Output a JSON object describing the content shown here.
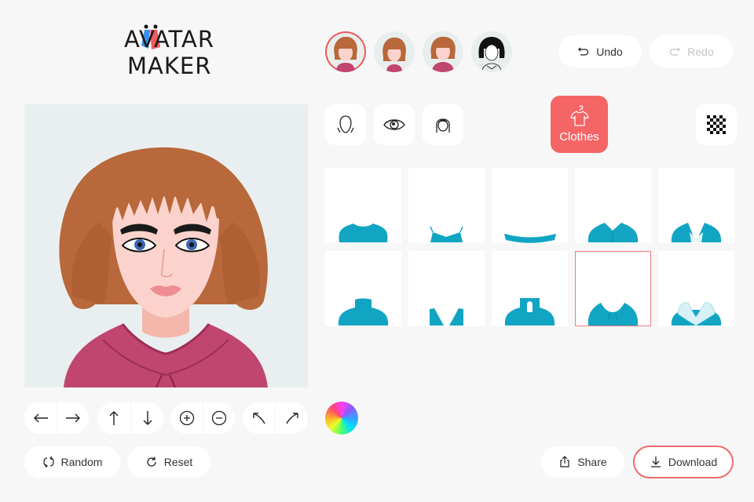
{
  "app": {
    "logo_line1": "AVATAR",
    "logo_line2": "MAKER",
    "logo_colors": {
      "blue": "#3a8ef0",
      "red": "#f25a5a"
    }
  },
  "presets": [
    {
      "name": "curly-hair-preset-1",
      "selected": true
    },
    {
      "name": "curly-hair-preset-2",
      "selected": false
    },
    {
      "name": "curly-hair-preset-3",
      "selected": false
    },
    {
      "name": "bob-hair-sketch-preset",
      "selected": false
    }
  ],
  "history": {
    "undo_label": "Undo",
    "redo_label": "Redo",
    "undo_icon": "undo-icon",
    "redo_icon": "redo-icon",
    "redo_enabled": false
  },
  "categories": [
    {
      "id": "face",
      "icon": "face-shape-icon",
      "active": false
    },
    {
      "id": "eyes",
      "icon": "eye-icon",
      "active": false
    },
    {
      "id": "hair",
      "icon": "hair-icon",
      "active": false
    },
    {
      "id": "clothes",
      "label": "Clothes",
      "icon": "hanger-shirt-icon",
      "active": true
    },
    {
      "id": "background",
      "icon": "checkerboard-icon",
      "active": false
    }
  ],
  "clothes_items": [
    {
      "style": "crew-neck-top",
      "selected": false
    },
    {
      "style": "strappy-top",
      "selected": false
    },
    {
      "style": "ruffle-off-shoulder",
      "selected": false
    },
    {
      "style": "collared-shirt",
      "selected": false
    },
    {
      "style": "blazer-with-tee",
      "selected": false
    },
    {
      "style": "turtleneck",
      "selected": false
    },
    {
      "style": "v-neck-tank",
      "selected": false
    },
    {
      "style": "keyhole-high-neck",
      "selected": false
    },
    {
      "style": "hoodie",
      "selected": true
    },
    {
      "style": "fur-collar-coat",
      "selected": false
    }
  ],
  "colors": {
    "accent": "#f56565",
    "clothing": "#12a5c3",
    "canvas_bg": "#e9eff0",
    "page_bg": "#f7f7f7",
    "hoodie": "#c0456f",
    "hair": "#b8683a",
    "skin": "#fbd3cc"
  },
  "position_controls": [
    {
      "group": "horizontal",
      "buttons": [
        "arrow-left-icon",
        "arrow-right-icon"
      ]
    },
    {
      "group": "vertical",
      "buttons": [
        "arrow-up-icon",
        "arrow-down-icon"
      ]
    },
    {
      "group": "zoom",
      "buttons": [
        "zoom-in-icon",
        "zoom-out-icon"
      ]
    },
    {
      "group": "rotate",
      "buttons": [
        "rotate-left-icon",
        "rotate-right-icon"
      ]
    }
  ],
  "actions": {
    "random_label": "Random",
    "reset_label": "Reset",
    "share_label": "Share",
    "download_label": "Download"
  }
}
